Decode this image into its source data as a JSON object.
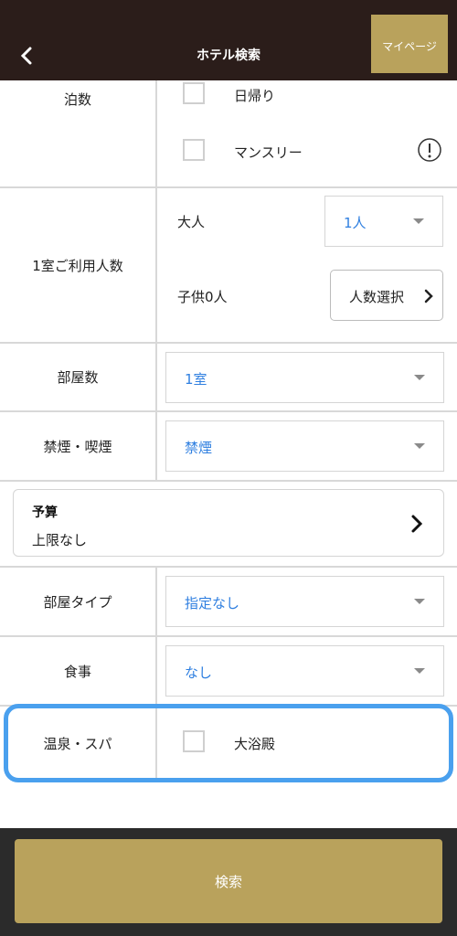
{
  "header": {
    "title": "ホテル検索",
    "mypage_label": "マイページ"
  },
  "nights": {
    "label": "泊数",
    "options": [
      {
        "label": "日帰り",
        "checked": false
      },
      {
        "label": "マンスリー",
        "checked": false
      }
    ]
  },
  "guests": {
    "label": "1室ご利用人数",
    "adult_label": "大人",
    "adult_value": "1人",
    "child_label": "子供0人",
    "child_button": "人数選択"
  },
  "rooms": {
    "label": "部屋数",
    "value": "1室"
  },
  "smoking": {
    "label": "禁煙・喫煙",
    "value": "禁煙"
  },
  "budget": {
    "title": "予算",
    "value": "上限なし"
  },
  "room_type": {
    "label": "部屋タイプ",
    "value": "指定なし"
  },
  "meal": {
    "label": "食事",
    "value": "なし"
  },
  "onsen": {
    "label": "温泉・スパ",
    "option": {
      "label": "大浴殿",
      "checked": false
    }
  },
  "footer": {
    "search_label": "検索"
  },
  "colors": {
    "header_bg": "#2b1d1a",
    "accent_gold": "#b9a25c",
    "select_text": "#2f7fe0",
    "highlight": "#4aa0ee"
  }
}
